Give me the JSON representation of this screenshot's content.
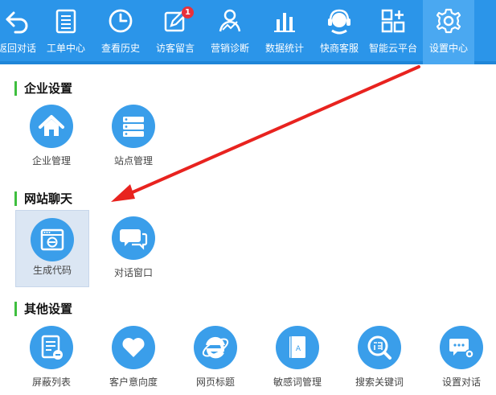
{
  "colors": {
    "accent": "#2b95e9",
    "active_tab": "#4aa8f1",
    "section_bar": "#3fbf3f",
    "badge": "#e8313b",
    "icon_circle": "#3a9eea",
    "arrow": "#e8231f"
  },
  "nav": {
    "items": [
      {
        "label": "返回对话",
        "icon": "back-arrow-icon"
      },
      {
        "label": "工单中心",
        "icon": "list-icon"
      },
      {
        "label": "查看历史",
        "icon": "clock-icon"
      },
      {
        "label": "访客留言",
        "icon": "edit-icon",
        "badge": "1"
      },
      {
        "label": "营销诊断",
        "icon": "chart-person-icon"
      },
      {
        "label": "数据统计",
        "icon": "bar-chart-icon"
      },
      {
        "label": "快商客服",
        "icon": "headset-icon"
      },
      {
        "label": "智能云平台",
        "icon": "grid-plus-icon"
      },
      {
        "label": "设置中心",
        "icon": "gear-icon",
        "active": true
      }
    ]
  },
  "sections": [
    {
      "title": "企业设置",
      "tiles": [
        {
          "label": "企业管理",
          "icon": "home-icon"
        },
        {
          "label": "站点管理",
          "icon": "server-icon"
        }
      ]
    },
    {
      "title": "网站聊天",
      "tiles": [
        {
          "label": "生成代码",
          "icon": "browser-code-icon",
          "selected": true
        },
        {
          "label": "对话窗口",
          "icon": "chat-bubbles-icon"
        }
      ]
    },
    {
      "title": "其他设置",
      "tiles": [
        {
          "label": "屏蔽列表",
          "icon": "block-list-icon"
        },
        {
          "label": "客户意向度",
          "icon": "heart-icon"
        },
        {
          "label": "网页标题",
          "icon": "ie-icon"
        },
        {
          "label": "敏感词管理",
          "icon": "book-icon"
        },
        {
          "label": "搜索关键词",
          "icon": "search-word-icon"
        },
        {
          "label": "设置对话",
          "icon": "chat-gear-icon"
        }
      ]
    }
  ]
}
